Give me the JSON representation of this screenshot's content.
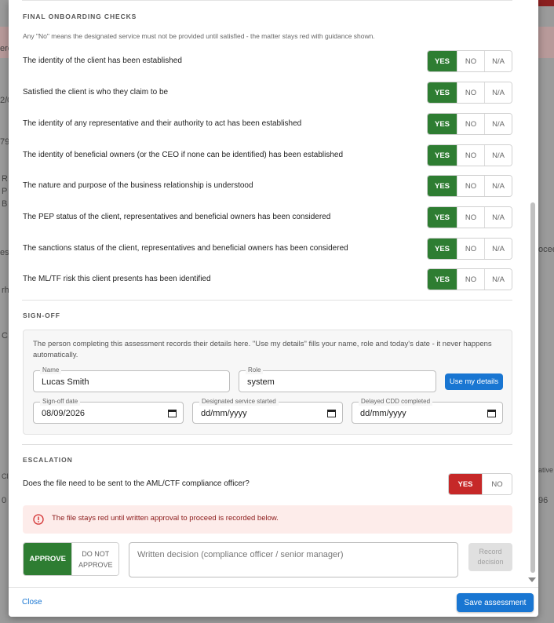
{
  "colors": {
    "yes_green": "#2e7d32",
    "yes_red": "#c62828",
    "primary_blue": "#1976d2",
    "alert_bg": "#fdecea"
  },
  "final_checks": {
    "title": "FINAL ONBOARDING CHECKS",
    "note": "Any \"No\" means the designated service must not be provided until satisfied - the matter stays red with guidance shown.",
    "options": {
      "yes": "YES",
      "no": "NO",
      "na": "N/A"
    },
    "items": [
      {
        "label": "The identity of the client has been established",
        "selected": "YES"
      },
      {
        "label": "Satisfied the client is who they claim to be",
        "selected": "YES"
      },
      {
        "label": "The identity of any representative and their authority to act has been established",
        "selected": "YES"
      },
      {
        "label": "The identity of beneficial owners (or the CEO if none can be identified) has been established",
        "selected": "YES"
      },
      {
        "label": "The nature and purpose of the business relationship is understood",
        "selected": "YES"
      },
      {
        "label": "The PEP status of the client, representatives and beneficial owners has been considered",
        "selected": "YES"
      },
      {
        "label": "The sanctions status of the client, representatives and beneficial owners has been considered",
        "selected": "YES"
      },
      {
        "label": "The ML/TF risk this client presents has been identified",
        "selected": "YES"
      }
    ]
  },
  "signoff": {
    "title": "SIGN-OFF",
    "note": "The person completing this assessment records their details here. \"Use my details\" fills your name, role and today's date - it never happens automatically.",
    "name_label": "Name",
    "name_value": "Lucas Smith",
    "role_label": "Role",
    "role_value": "system",
    "use_my_details": "Use my details",
    "signoff_date_label": "Sign-off date",
    "signoff_date_value": "08/09/2026",
    "service_started_label": "Designated service started",
    "service_started_value": "dd/mm/yyyy",
    "cdd_completed_label": "Delayed CDD completed",
    "cdd_completed_value": "dd/mm/yyyy"
  },
  "escalation": {
    "title": "ESCALATION",
    "question": "Does the file need to be sent to the AML/CTF compliance officer?",
    "yes": "YES",
    "no": "NO",
    "selected": "YES",
    "alert": "The file stays red until written approval to proceed is recorded below.",
    "approve": "APPROVE",
    "do_not_approve_1": "DO NOT",
    "do_not_approve_2": "APPROVE",
    "decision_placeholder": "Written decision (compliance officer / senior manager)",
    "record_1": "Record",
    "record_2": "decision"
  },
  "footer": {
    "close": "Close",
    "save": "Save assessment"
  },
  "background": {
    "frag_1": "ero",
    "frag_2": "2/0",
    "frag_3": "79",
    "frag_4": "R",
    "frag_5": "P",
    "frag_6": "B",
    "frag_7": "es",
    "frag_8": "rh",
    "frag_9": "C",
    "frag_10": "ocee",
    "frag_11": "ative",
    "frag_12": "96",
    "frag_13": "Cl",
    "frag_14": "0"
  }
}
